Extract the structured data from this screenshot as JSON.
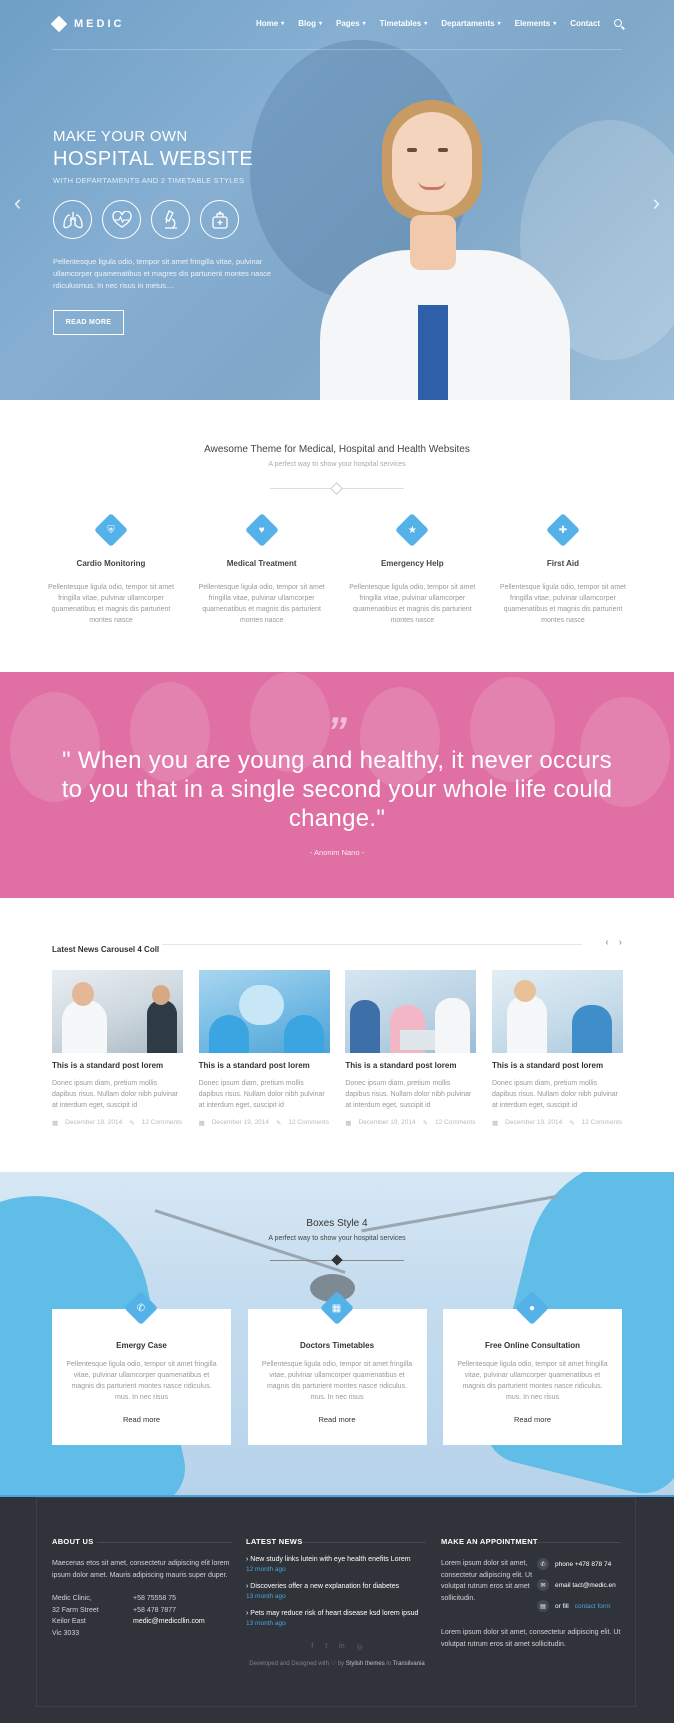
{
  "header": {
    "logo": "MEDIC",
    "nav": [
      {
        "label": "Home",
        "has_dropdown": true
      },
      {
        "label": "Blog",
        "has_dropdown": true
      },
      {
        "label": "Pages",
        "has_dropdown": true
      },
      {
        "label": "Timetables",
        "has_dropdown": true
      },
      {
        "label": "Departaments",
        "has_dropdown": true
      },
      {
        "label": "Elements",
        "has_dropdown": true
      },
      {
        "label": "Contact",
        "has_dropdown": false
      }
    ]
  },
  "hero": {
    "kicker": "MAKE YOUR OWN",
    "title": "HOSPITAL WEBSITE",
    "subtitle": "WITH DEPARTAMENTS AND 2 TIMETABLE STYLES",
    "icons": [
      "lungs-icon",
      "heartbeat-icon",
      "microscope-icon",
      "medical-kit-icon"
    ],
    "description": "Pellentesque ligula odio, tempor sit amet fringilla vitae, pulvinar ullamcorper quamenatibus et magres dis parturient montes nasce rdiculusmus. In nec risus in metus....",
    "button": "READ MORE"
  },
  "intro": {
    "title": "Awesome Theme for Medical, Hospital and Health Websites",
    "subtitle": "A perfect way to show your hospital services"
  },
  "features": [
    {
      "title": "Cardio Monitoring",
      "icon": "shield-icon",
      "text": "Pellentesque ligula odio, tempor sit amet fringilla vitae, pulvinar ullamcorper quamenatibus et magnis dis parturient montes nasce"
    },
    {
      "title": "Medical Treatment",
      "icon": "heart-icon",
      "text": "Pellentesque ligula odio, tempor sit amet fringilla vitae, pulvinar ullamcorper quamenatibus et magnis dis parturient montes nasce"
    },
    {
      "title": "Emergency Help",
      "icon": "star-icon",
      "text": "Pellentesque ligula odio, tempor sit amet fringilla vitae, pulvinar ullamcorper quamenatibus et magnis dis parturient montes nasce"
    },
    {
      "title": "First Aid",
      "icon": "medkit-icon",
      "text": "Pellentesque ligula odio, tempor sit amet fringilla vitae, pulvinar ullamcorper quamenatibus et magnis dis parturient montes nasce"
    }
  ],
  "quote": {
    "mark": "”",
    "text": "\" When you are young and healthy, it never occurs to you that in a single second your whole life could change.\"",
    "author": "- Anonim Nano -"
  },
  "news": {
    "title": "Latest News Carousel 4 Coll",
    "prev": "‹",
    "next": "›",
    "items": [
      {
        "title": "This is a standard post lorem",
        "text": "Donec ipsum diam, pretium mollis dapibus risus. Nullam dolor nibh pulvinar at interdum eget, suscipit id",
        "date": "December 19, 2014",
        "comments": "12 Comments"
      },
      {
        "title": "This is a standard post lorem",
        "text": "Donec ipsum diam, pretium mollis dapibus risus. Nullam dolor nibh pulvinar at interdum eget, suscipit id",
        "date": "December 19, 2014",
        "comments": "12 Comments"
      },
      {
        "title": "This is a standard post lorem",
        "text": "Donec ipsum diam, pretium mollis dapibus risus. Nullam dolor nibh pulvinar at interdum eget, suscipit id",
        "date": "December 19, 2014",
        "comments": "12 Comments"
      },
      {
        "title": "This is a standard post lorem",
        "text": "Donec ipsum diam, pretium mollis dapibus risus. Nullam dolor nibh pulvinar at interdum eget, suscipit id",
        "date": "December 19, 2014",
        "comments": "12 Comments"
      }
    ]
  },
  "boxes": {
    "title": "Boxes Style 4",
    "subtitle": "A perfect way to show your hospital services",
    "items": [
      {
        "title": "Emergy Case",
        "icon": "phone-icon",
        "text": "Pellentesque ligula odio, tempor sit amet fringilla vitae, pulvinar ullamcorper quamenatibus et magnis dis parturient montes nasce ridiculus. mus. In nec risus",
        "link": "Read more"
      },
      {
        "title": "Doctors Timetables",
        "icon": "calendar-icon",
        "text": "Pellentesque ligula odio, tempor sit amet fringilla vitae, pulvinar ullamcorper quamenatibus et magnis dis parturient montes nasce ridiculus. mus. In nec risus",
        "link": "Read more"
      },
      {
        "title": "Free Online Consultation",
        "icon": "chat-icon",
        "text": "Pellentesque ligula odio, tempor sit amet fringilla vitae, pulvinar ullamcorper quamenatibus et magnis dis parturient montes nasce ridiculus. mus. In nec risus",
        "link": "Read more"
      }
    ]
  },
  "footer": {
    "about": {
      "title": "ABOUT US",
      "text": "Maecenas etos sit amet, consectetur adipiscing elit lorem ipsum dolor amet. Mauris adipiscing mauris super duper.",
      "address_lines": [
        "Medic Clinic,",
        "32 Farm Street",
        "Keilor East",
        "Vic 3033"
      ],
      "phones": [
        "+58 75558 75",
        "+58 478 7877"
      ],
      "email": "medic@mediccllin.com"
    },
    "latest": {
      "title": "LATEST NEWS",
      "items": [
        {
          "title": "New study links lutein with eye health enefits Lorem",
          "date": "12 month ago"
        },
        {
          "title": "Discoveries offer a new explanation for diabetes",
          "date": "13 month ago"
        },
        {
          "title": "Pets may reduce risk of heart disease ksd lorem ipsud",
          "date": "13 month ago"
        }
      ]
    },
    "appointment": {
      "title": "MAKE AN APPOINTMENT",
      "text": "Lorem ipsum dolor sit amet, consectetur adipiscing elit. Ut volutpat rutrum eros sit amet sollicitudin.",
      "phone": "phone +478 878 74",
      "email": "email tact@medic.en",
      "fill_prefix": "or fill",
      "fill_link": "contact form",
      "text2": "Lorem ipsum dolor sit amet, consectetur adipiscing elit. Ut volutpat rutrum eros sit amet sollicitudin."
    },
    "socials": [
      "f",
      "t",
      "in",
      "◎"
    ],
    "credit_prefix": "Developed and Designed with ♡ by",
    "credit_by": "Stylish themes",
    "credit_in": "in",
    "credit_place": "Transilvania"
  },
  "colors": {
    "accent": "#55b2e8",
    "quote_bg": "#e070a4",
    "footer_bg": "#30343a"
  }
}
